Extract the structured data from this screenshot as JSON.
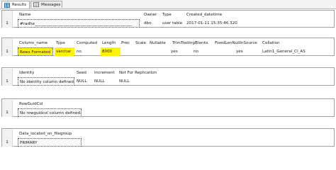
{
  "tabs": [
    {
      "label": "Results",
      "icon": "grid-icon",
      "active": true
    },
    {
      "label": "Messages",
      "icon": "messages-icon",
      "active": false
    }
  ],
  "grid1": {
    "columns": [
      "Name",
      "Owner",
      "Type",
      "Created_datetime"
    ],
    "row_number": "1",
    "row": [
      "#radhe_________________________________________________",
      "dbo",
      "user table",
      "2017-01-11 15:35:46.320"
    ]
  },
  "grid2": {
    "columns": [
      "Column_name",
      "Type",
      "Computed",
      "Length",
      "Prec",
      "Scale",
      "Nullable",
      "TrimTrailingBlanks",
      "FixedLenNullInSource",
      "Collation"
    ],
    "row_number": "1",
    "row": [
      "Rows Formated",
      "varchar",
      "no",
      "8000",
      "",
      "",
      "yes",
      "no",
      "yes",
      "Latin1_General_CI_AS"
    ],
    "highlight_color": "#fff200"
  },
  "grid3": {
    "columns": [
      "Identity",
      "Seed",
      "Increment",
      "Not For Replication"
    ],
    "row_number": "1",
    "row": [
      "No identity column defined.",
      "NULL",
      "NULL",
      "NULL"
    ]
  },
  "grid4": {
    "columns": [
      "RowGuidCol"
    ],
    "row_number": "1",
    "row": [
      "No rowguidcol column defined."
    ]
  },
  "grid5": {
    "columns": [
      "Data_located_on_filegroup"
    ],
    "row_number": "1",
    "row": [
      "PRIMARY"
    ]
  }
}
